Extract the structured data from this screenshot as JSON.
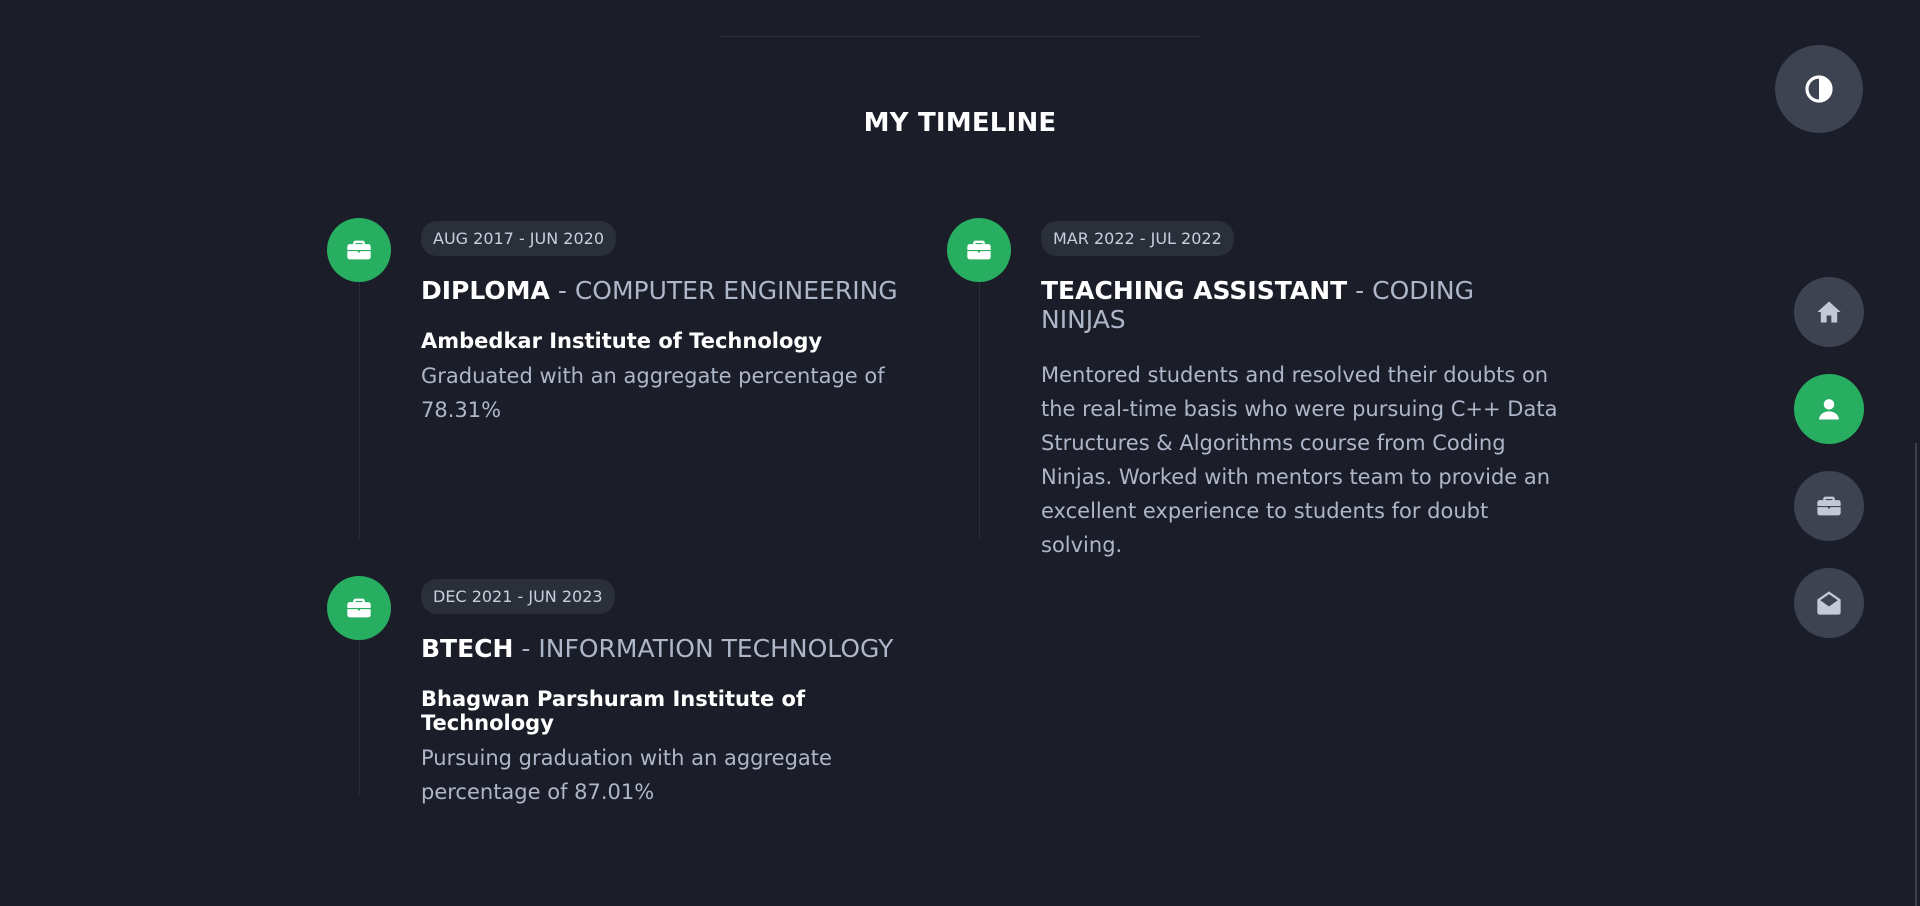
{
  "section": {
    "title": "MY TIMELINE"
  },
  "timeline": [
    {
      "date": "AUG 2017 - JUN 2020",
      "role": "DIPLOMA",
      "separator": " - ",
      "field": "COMPUTER ENGINEERING",
      "institution": "Ambedkar Institute of Technology",
      "description": "Graduated with an aggregate percentage of 78.31%",
      "icon": "briefcase-icon"
    },
    {
      "date": "MAR 2022 - JUL 2022",
      "role": "TEACHING ASSISTANT",
      "separator": " - ",
      "field": "CODING NINJAS",
      "institution": "",
      "description": "Mentored students and resolved their doubts on the real-time basis who were pursuing C++ Data Structures & Algorithms course from Coding Ninjas. Worked with mentors team to provide an excellent experience to students for doubt solving.",
      "icon": "briefcase-icon"
    },
    {
      "date": "DEC 2021 - JUN 2023",
      "role": "BTECH",
      "separator": " - ",
      "field": "INFORMATION TECHNOLOGY",
      "institution": "Bhagwan Parshuram Institute of Technology",
      "description": "Pursuing graduation with an aggregate percentage of 87.01%",
      "icon": "briefcase-icon"
    }
  ],
  "nav": {
    "items": [
      {
        "name": "home",
        "icon": "home-icon",
        "active": false
      },
      {
        "name": "about",
        "icon": "user-icon",
        "active": true
      },
      {
        "name": "portfolio",
        "icon": "briefcase-icon",
        "active": false
      },
      {
        "name": "contact",
        "icon": "envelope-open-icon",
        "active": false
      }
    ]
  },
  "theme_toggle": {
    "icon": "contrast-icon"
  },
  "colors": {
    "background": "#1b1e28",
    "accent": "#27ae60",
    "fab": "#3d4350",
    "text_muted": "#aeb6c8",
    "badge": "#2b2f3a"
  }
}
